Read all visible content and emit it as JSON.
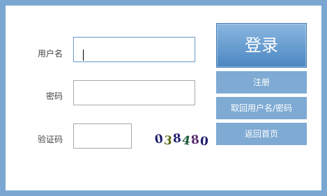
{
  "form": {
    "username_label": "用户名",
    "password_label": "密码",
    "captcha_label": "验证码",
    "username_value": "",
    "password_value": "",
    "captcha_value": ""
  },
  "captcha_image": {
    "chars": [
      "0",
      "3",
      "8",
      "4",
      "8",
      "0"
    ],
    "colors": [
      "#1d1d6e",
      "#5a6b1a",
      "#1d1d6e",
      "#1e5a3a",
      "#5a2a6e",
      "#1d1d6e"
    ]
  },
  "buttons": {
    "login": "登录",
    "register": "注册",
    "recover": "取回用户名/密码",
    "home": "返回首页"
  },
  "colors": {
    "frame": "#7aa7d1",
    "button": "#7eaad3",
    "login_gradient_top": "#8cb7e0",
    "login_gradient_bottom": "#4a87c2"
  }
}
